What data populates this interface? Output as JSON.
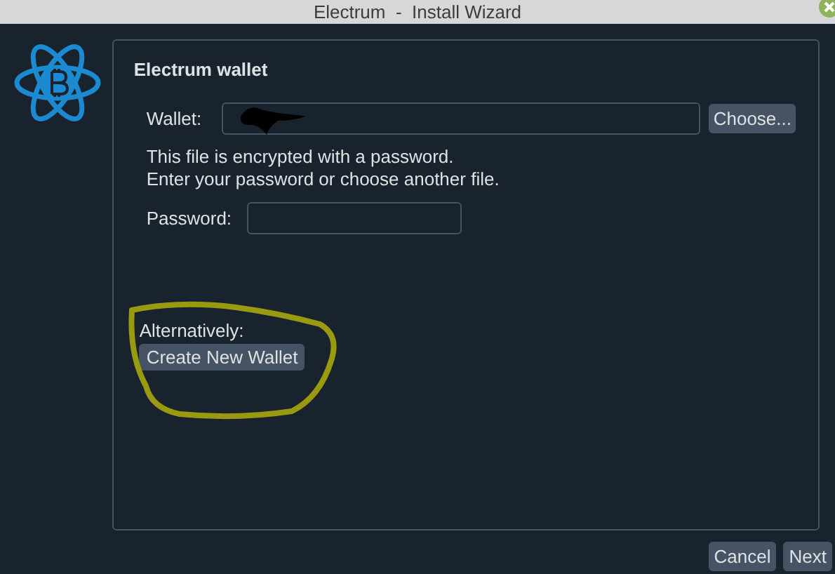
{
  "window": {
    "title": "Electrum  -  Install Wizard"
  },
  "panel": {
    "title": "Electrum wallet",
    "wallet": {
      "label": "Wallet:",
      "button": "Choose..."
    },
    "message": [
      "This file is encrypted with a password.",
      "Enter your password or choose another file."
    ],
    "password": {
      "label": "Password:"
    },
    "alternative": {
      "label": "Alternatively:",
      "button": "Create New Wallet"
    }
  },
  "buttons": [
    "Cancel",
    "Next"
  ]
}
